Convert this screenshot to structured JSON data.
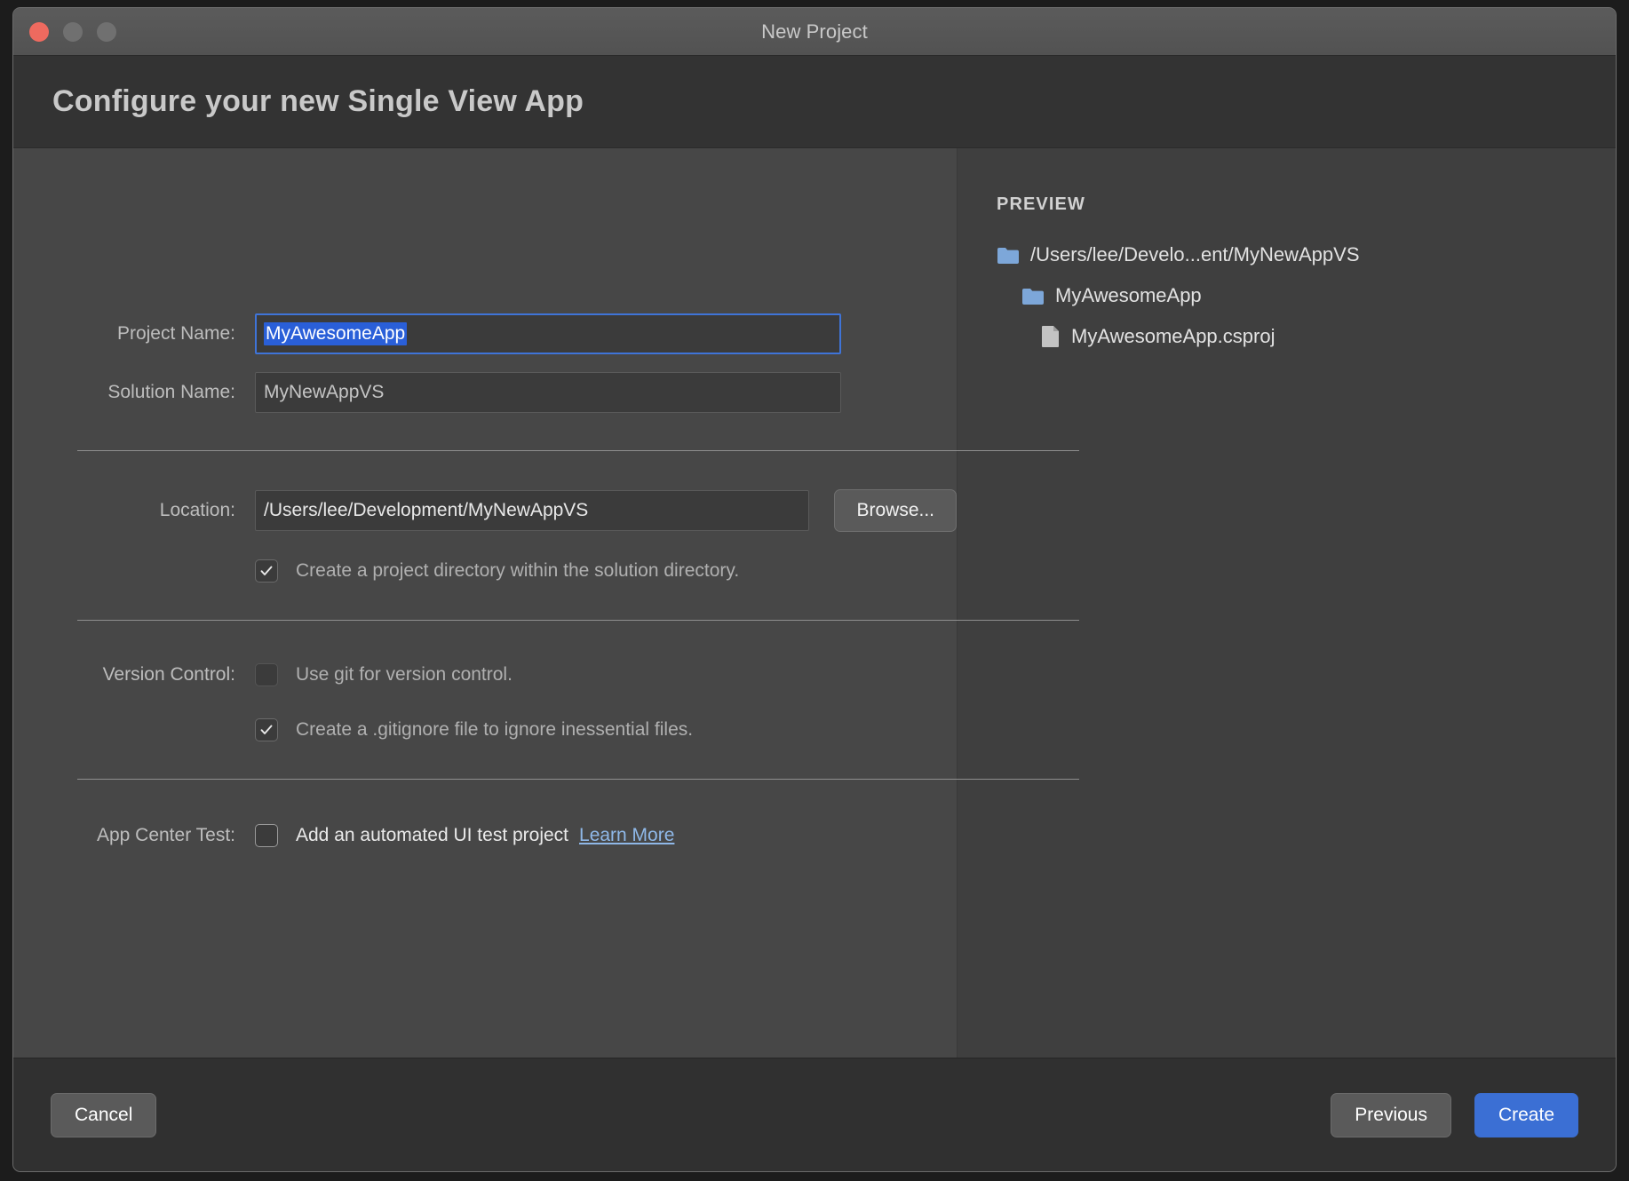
{
  "window": {
    "title": "New Project",
    "header_title": "Configure your new Single View App",
    "traffic_lights": {
      "close": "close-button",
      "minimize": "minimize-button",
      "zoom": "zoom-button"
    }
  },
  "form": {
    "project_name": {
      "label": "Project Name:",
      "value": "MyAwesomeApp",
      "placeholder": "Project Name"
    },
    "solution_name": {
      "label": "Solution Name:",
      "value": "MyNewAppVS",
      "placeholder": "Solution Name"
    },
    "location": {
      "label": "Location:",
      "value": "/Users/lee/Development/MyNewAppVS",
      "placeholder": "Location",
      "browse_label": "Browse..."
    },
    "create_project_directory": {
      "label": "Create a project directory within the solution directory.",
      "checked": true
    },
    "version_control": {
      "label": "Version Control:",
      "use_git": {
        "label": "Use git for version control.",
        "checked": false
      },
      "gitignore": {
        "label": "Create a .gitignore file to ignore inessential files.",
        "checked": true
      }
    },
    "app_center_test": {
      "label": "App Center Test:",
      "ui_test": {
        "label": "Add an automated UI test project",
        "checked": false
      },
      "learn_more": "Learn More"
    }
  },
  "preview": {
    "title": "PREVIEW",
    "tree": [
      {
        "label": "/Users/lee/Develo...ent/MyNewAppVS",
        "icon": "folder-icon",
        "level": 1
      },
      {
        "label": "MyAwesomeApp",
        "icon": "folder-icon",
        "level": 2
      },
      {
        "label": "MyAwesomeApp.csproj",
        "icon": "file-icon",
        "level": 3
      }
    ]
  },
  "footer": {
    "cancel": "Cancel",
    "previous": "Previous",
    "create": "Create"
  },
  "colors": {
    "accent": "#3b6fd4",
    "selection": "#2a5fd8",
    "link": "#8fb8e8",
    "folder": "#7da7d9",
    "close_button": "#ee6a5f"
  }
}
